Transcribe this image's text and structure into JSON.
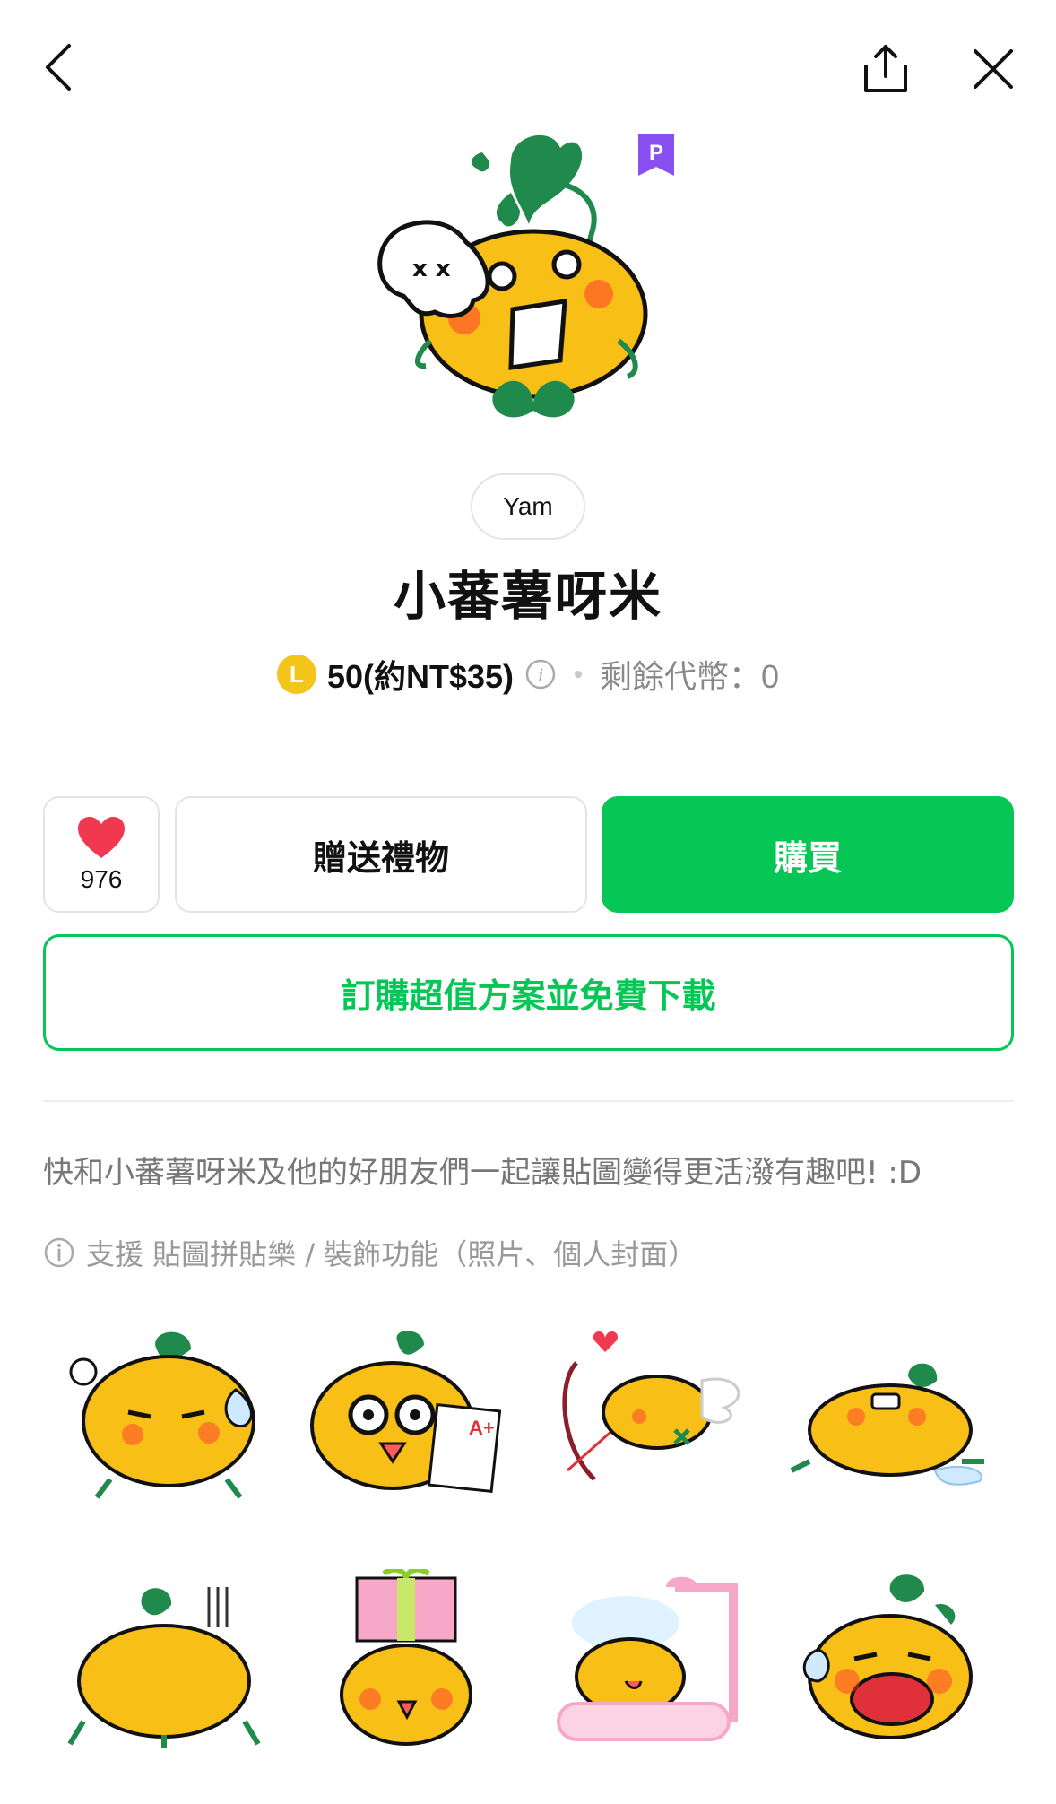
{
  "colors": {
    "accent": "#06c755",
    "heart": "#f0384f",
    "coin": "#f4c51b",
    "premium": "#8a4ff0",
    "text_secondary": "#888888"
  },
  "top_bar": {
    "back_icon": "chevron-left-icon",
    "share_icon": "share-icon",
    "close_icon": "close-icon"
  },
  "product": {
    "premium_badge": "P",
    "author": "Yam",
    "title": "小蕃薯呀米",
    "coin_letter": "L",
    "price": "50(約NT$35)",
    "remaining": "剩餘代幣：0"
  },
  "actions": {
    "like_count": "976",
    "gift_label": "贈送禮物",
    "buy_label": "購買",
    "subscribe_label": "訂購超值方案並免費下載"
  },
  "description": "快和小蕃薯呀米及他的好朋友們一起讓貼圖變得更活潑有趣吧! :D",
  "support_note": "支援 貼圖拼貼樂 / 裝飾功能（照片、個人封面）",
  "stickers": [
    "sticker-annoyed",
    "sticker-glasses-test",
    "sticker-cupid",
    "sticker-lying-crying",
    "sticker-back-view",
    "sticker-gift-box",
    "sticker-bath",
    "sticker-crying-loud"
  ]
}
